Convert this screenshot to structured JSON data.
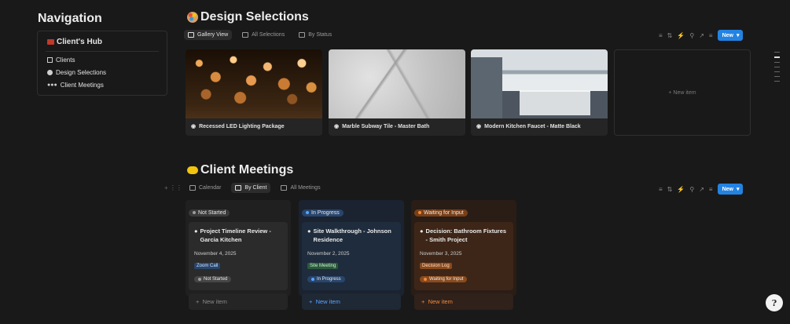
{
  "navigation": {
    "heading": "Navigation",
    "hub_title": "Client's Hub",
    "hub_icon": "toolbox-icon",
    "items": [
      {
        "label": "Clients",
        "icon": "building-icon"
      },
      {
        "label": "Design Selections",
        "icon": "palette-icon"
      },
      {
        "label": "Client Meetings",
        "icon": "people-icon"
      }
    ]
  },
  "design": {
    "title": "Design Selections",
    "icon": "palette-icon",
    "tabs": [
      "Gallery View",
      "All Selections",
      "By Status"
    ],
    "new_label": "New",
    "new_item_label": "New item",
    "cards": [
      {
        "title": "Recessed LED Lighting Package"
      },
      {
        "title": "Marble Subway Tile - Master Bath"
      },
      {
        "title": "Modern Kitchen Faucet - Matte Black"
      }
    ]
  },
  "meetings": {
    "title": "Client Meetings",
    "icon": "handshake-icon",
    "tabs": [
      "Calendar",
      "By Client",
      "All Meetings"
    ],
    "new_label": "New",
    "columns": [
      {
        "status": "Not Started",
        "title": "Project Timeline Review - Garcia Kitchen",
        "date": "November 4, 2025",
        "type": "Zoom Call",
        "new_item": "New item"
      },
      {
        "status": "In Progress",
        "title": "Site Walkthrough - Johnson Residence",
        "date": "November 2, 2025",
        "type": "Site Meeting",
        "new_item": "New item"
      },
      {
        "status": "Waiting for Input",
        "title": "Decision: Bathroom Fixtures - Smith Project",
        "date": "November 3, 2025",
        "type": "Decision Log",
        "new_item": "New item"
      }
    ]
  },
  "colors": {
    "accent": "#2383e2",
    "background": "#191919"
  }
}
